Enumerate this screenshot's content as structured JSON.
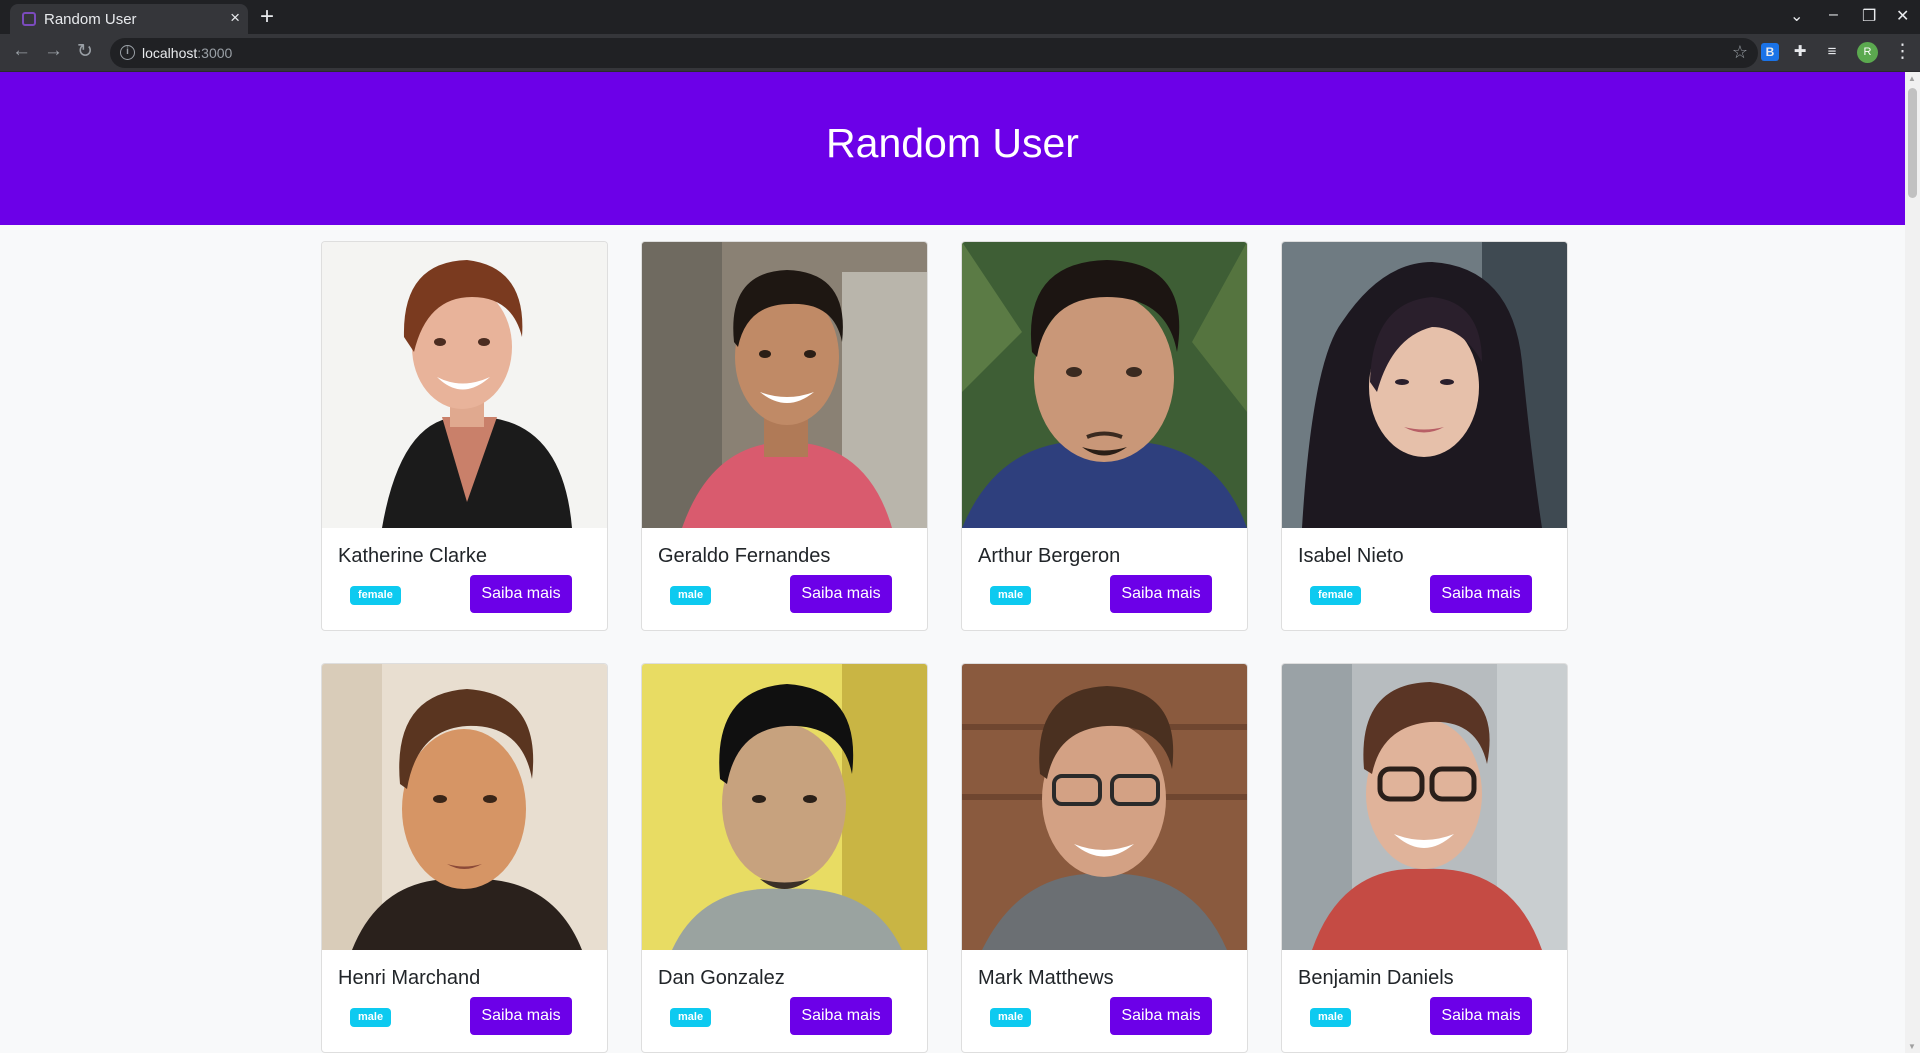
{
  "browser": {
    "tab_title": "Random User",
    "tab_close": "×",
    "new_tab": "+",
    "url_host": "localhost",
    "url_port": ":3000",
    "profile_initial": "R"
  },
  "page": {
    "title": "Random User",
    "button_label": "Saiba mais"
  },
  "users": [
    {
      "name": "Katherine Clarke",
      "gender": "female"
    },
    {
      "name": "Geraldo Fernandes",
      "gender": "male"
    },
    {
      "name": "Arthur Bergeron",
      "gender": "male"
    },
    {
      "name": "Isabel Nieto",
      "gender": "female"
    },
    {
      "name": "Henri Marchand",
      "gender": "male"
    },
    {
      "name": "Dan Gonzalez",
      "gender": "male"
    },
    {
      "name": "Mark Matthews",
      "gender": "male"
    },
    {
      "name": "Benjamin Daniels",
      "gender": "male"
    }
  ],
  "colors": {
    "primary": "#6c00e8",
    "badge": "#0dcaf0",
    "page_background": "#f8f9fa"
  }
}
